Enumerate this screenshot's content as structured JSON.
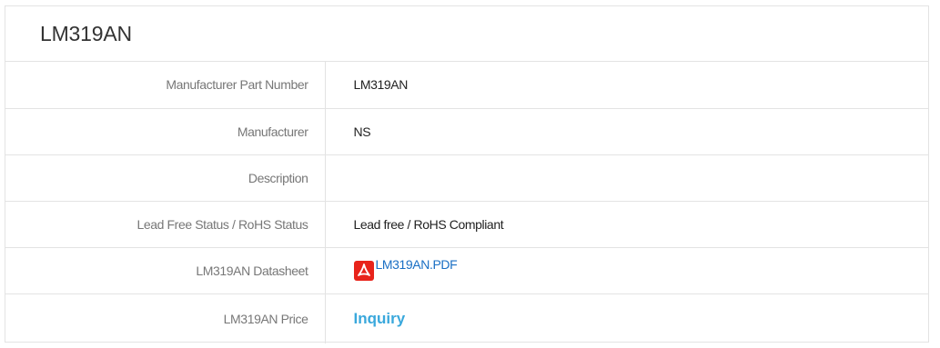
{
  "product": {
    "title": "LM319AN"
  },
  "specs": [
    {
      "label": "Manufacturer Part Number",
      "value": "LM319AN"
    },
    {
      "label": "Manufacturer",
      "value": "NS"
    },
    {
      "label": "Description",
      "value": ""
    },
    {
      "label": "Lead Free Status / RoHS Status",
      "value": "Lead free / RoHS Compliant"
    },
    {
      "label": "LM319AN Datasheet",
      "value": "LM319AN.PDF",
      "icon": "pdf-icon"
    },
    {
      "label": "LM319AN Price",
      "value": "Inquiry"
    }
  ],
  "colors": {
    "link": "#1a6fc4",
    "inquiry": "#3aa8dc",
    "pdf_icon": "#e8231a",
    "border": "#e3e3e3"
  }
}
